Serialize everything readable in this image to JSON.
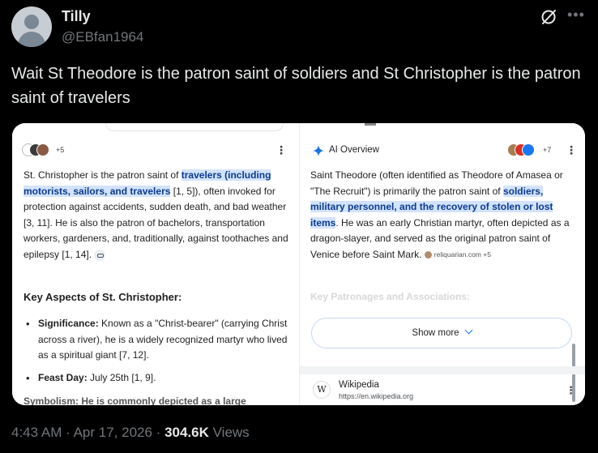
{
  "tweet": {
    "display_name": "Tilly",
    "handle": "@EBfan1964",
    "text": "Wait St Theodore is the patron saint of soldiers and St Christopher is the patron saint of travelers",
    "time": "4:43 AM",
    "date": "Apr 17, 2026",
    "views_count": "304.6K",
    "views_label": "Views",
    "separator": "·"
  },
  "left_panel": {
    "avatar_count": "+5",
    "kebab": "⋮",
    "para_1": "St. Christopher is the patron saint of ",
    "para_highlight": "travelers (including motorists, sailors, and travelers",
    "para_2": " [1, 5]), often invoked for protection against accidents, sudden death, and bad weather [3, 11]. He is also the patron of bachelors, transportation workers, gardeners, and, traditionally, against toothaches and epilepsy [1, 14].",
    "heading": "Key Aspects of St. Christopher:",
    "bullets": [
      {
        "label": "Significance:",
        "text": " Known as a \"Christ-bearer\" (carrying Christ across a river), he is a widely recognized martyr who lived as a spiritual giant [7, 12]."
      },
      {
        "label": "Feast Day:",
        "text": " July 25th [1, 9]."
      }
    ],
    "cut_text": "Symbolism: He is commonly depicted as a large"
  },
  "right_panel": {
    "ai_label": "AI Overview",
    "avatar_count": "+7",
    "kebab": "⋮",
    "para_1": "Saint Theodore (often identified as Theodore of Amasea or \"The Recruit\") is primarily the patron saint of ",
    "para_highlight": "soldiers, military personnel, and the recovery of stolen or lost items",
    "para_2": ". He was an early Christian martyr, often depicted as a dragon-slayer, and served as the original patron saint of Venice before Saint Mark.",
    "source_chip": "reliquarian.com +5",
    "faded_heading": "Key Patronages and Associations:",
    "show_more": "Show more",
    "wiki_letter": "W",
    "wiki_title": "Wikipedia",
    "wiki_url": "https://en.wikipedia.org"
  },
  "icons": {
    "grok": "grok-icon",
    "more": "more-icon",
    "spark": "ai-sparkle-icon"
  },
  "colors": {
    "highlight_bg": "#d3e3fd",
    "accent_blue": "#1a73e8",
    "muted": "#71767b"
  }
}
